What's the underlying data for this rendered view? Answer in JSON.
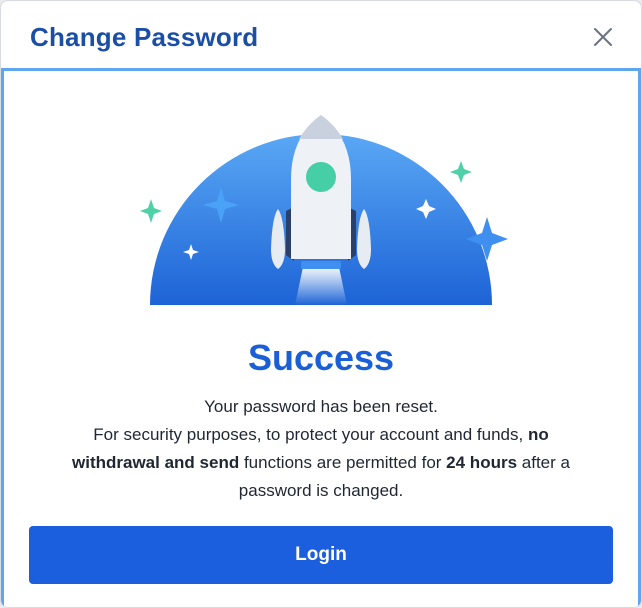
{
  "dialog": {
    "title": "Change Password",
    "close_icon": "close-icon"
  },
  "illustration": {
    "icon": "rocket-launch-icon",
    "colors": {
      "sky_top": "#5aa8f5",
      "sky_bottom": "#1d63d6",
      "sparkle_green": "#4fd1a8",
      "rocket_body": "#eef1f6",
      "rocket_window": "#46cea6"
    }
  },
  "success": {
    "title": "Success",
    "line1": "Your password has been reset.",
    "line2_prefix": "For security purposes, to protect your account and funds,",
    "line2_bold": "no",
    "line3_bold": "withdrawal and send",
    "line3_middle": "functions are permitted for",
    "line3_bold2": "24 hours",
    "line3_suffix": "after a",
    "line4": "password is changed."
  },
  "actions": {
    "login_label": "Login"
  },
  "colors": {
    "title": "#1b4fa5",
    "accent": "#1b5fde",
    "frame_border": "#5ea6ee"
  }
}
